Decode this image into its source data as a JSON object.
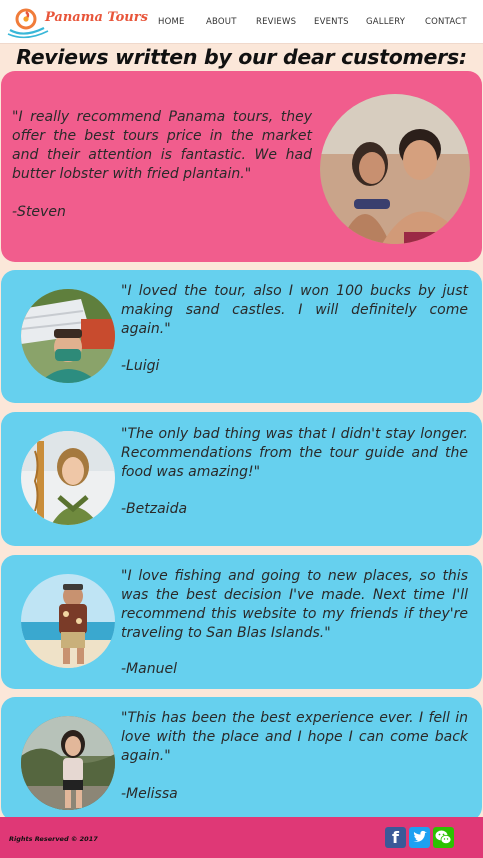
{
  "brand": {
    "name": "Panama Tours"
  },
  "nav": {
    "items": [
      {
        "label": "HOME"
      },
      {
        "label": "ABOUT"
      },
      {
        "label": "REVIEWS"
      },
      {
        "label": "EVENTS"
      },
      {
        "label": "GALLERY"
      },
      {
        "label": "CONTACT"
      }
    ]
  },
  "page": {
    "title": "Reviews written by our dear customers:"
  },
  "reviews": [
    {
      "quote": "\"I really recommend Panama tours, they offer the best tours price in the market and their attention is fantastic. We had butter lobster with fried plantain.\"",
      "author": "-Steven",
      "color": "#f15d8d"
    },
    {
      "quote": "\"I loved the tour, also I won 100 bucks by just making sand castles. I will definitely come again.\"",
      "author": "-Luigi",
      "color": "#66d0ee"
    },
    {
      "quote": "\"The only bad thing was that I didn't stay longer. Recommendations from the tour guide and the food was amazing!\"",
      "author": "-Betzaida",
      "color": "#66d0ee"
    },
    {
      "quote": "\"I love fishing and going to new places, so this was the best decision I've made. Next time I'll recommend this website to my friends if they're traveling to San Blas Islands.\"",
      "author": "-Manuel",
      "color": "#66d0ee"
    },
    {
      "quote": "\"This has been the best experience ever. I fell in love with the place and I hope I can come back again.\"",
      "author": "-Melissa",
      "color": "#66d0ee"
    }
  ],
  "footer": {
    "copyright": "Rights Reserved © 2017",
    "social": [
      {
        "icon": "facebook-icon",
        "glyph": "f",
        "color": "#3b5998"
      },
      {
        "icon": "twitter-icon",
        "glyph": "t",
        "color": "#1da1f2"
      },
      {
        "icon": "wechat-icon",
        "glyph": "w",
        "color": "#2dc100"
      }
    ]
  },
  "colors": {
    "background": "#fbe7d9",
    "accent_pink": "#f15d8d",
    "card_blue": "#66d0ee",
    "footer": "#df3876"
  }
}
